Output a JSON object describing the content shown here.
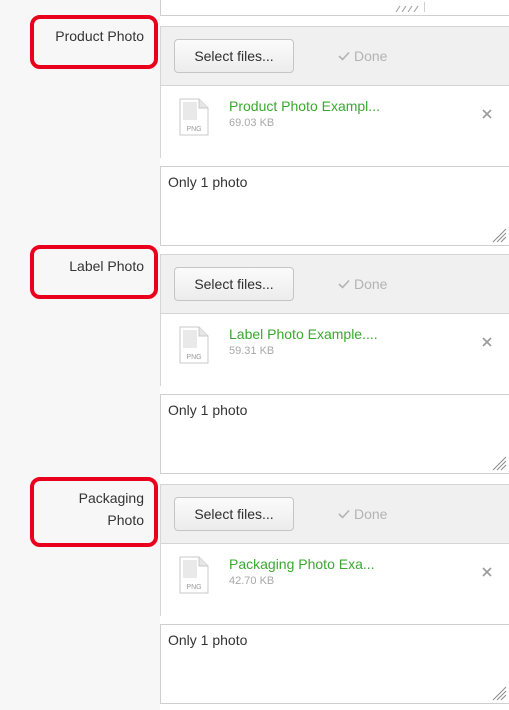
{
  "sections": [
    {
      "label": "Product Photo",
      "select_label": "Select files...",
      "done_label": "Done",
      "file": {
        "type": "PNG",
        "name": "Product Photo Exampl...",
        "size": "69.03 KB"
      },
      "note": "Only 1 photo"
    },
    {
      "label": "Label Photo",
      "select_label": "Select files...",
      "done_label": "Done",
      "file": {
        "type": "PNG",
        "name": "Label Photo Example....",
        "size": "59.31 KB"
      },
      "note": "Only 1 photo"
    },
    {
      "label_line1": "Packaging",
      "label_line2": "Photo",
      "select_label": "Select files...",
      "done_label": "Done",
      "file": {
        "type": "PNG",
        "name": "Packaging Photo Exa...",
        "size": "42.70 KB"
      },
      "note": "Only 1 photo"
    }
  ],
  "colors": {
    "highlight": "#e8001c",
    "file_name": "#3aa830",
    "done": "#b3b3b3",
    "panel": "#f7f7f7",
    "toolbar": "#f0f0f0"
  },
  "icons": {
    "file": "png-file-icon",
    "done": "check-icon",
    "remove": "close-icon",
    "grip": "resize-grip-icon"
  }
}
